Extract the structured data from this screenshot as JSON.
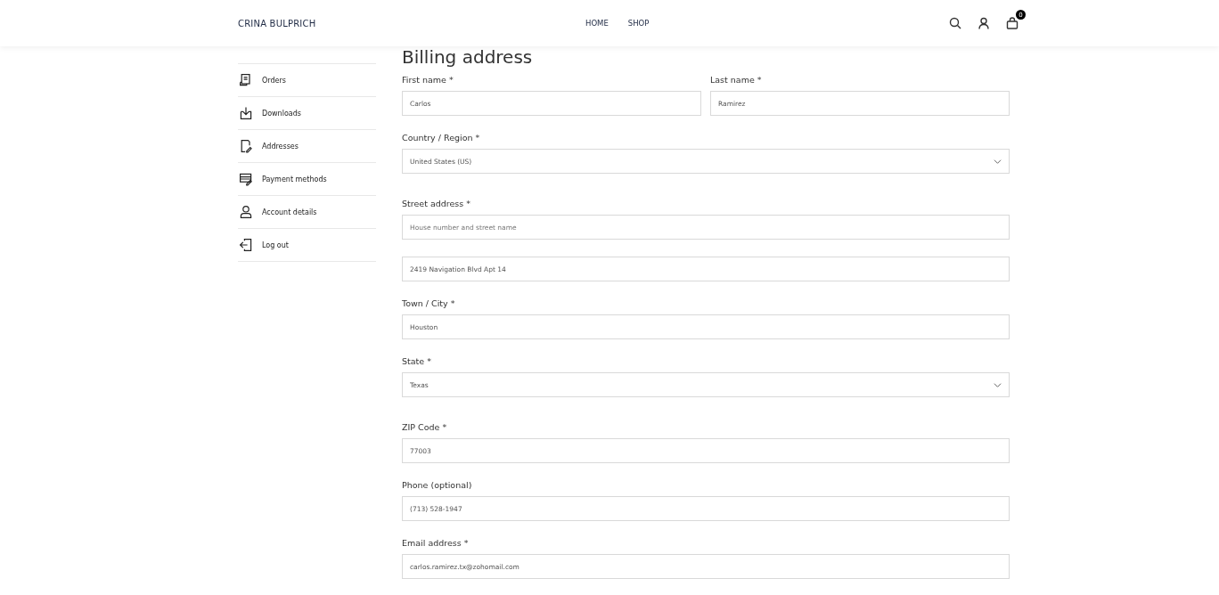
{
  "header": {
    "brand": "CRINA BULPRICH",
    "nav": [
      {
        "label": "HOME"
      },
      {
        "label": "SHOP"
      }
    ],
    "cart_count": "0"
  },
  "sidebar": {
    "items": [
      {
        "label": "Orders"
      },
      {
        "label": "Downloads"
      },
      {
        "label": "Addresses"
      },
      {
        "label": "Payment methods"
      },
      {
        "label": "Account details"
      },
      {
        "label": "Log out"
      }
    ]
  },
  "form": {
    "title": "Billing address",
    "rows": [
      {
        "fields": [
          {
            "kind": "text",
            "label": "First name *",
            "value": "Carlos"
          },
          {
            "kind": "text",
            "label": "Last name *",
            "value": "Ramirez"
          }
        ]
      },
      {
        "fields": [
          {
            "kind": "select",
            "label": "Country / Region *",
            "value": "United States (US)"
          }
        ]
      },
      {
        "fields": [
          {
            "kind": "text",
            "label": "Street address *",
            "placeholder": "House number and street name"
          }
        ]
      },
      {
        "fields": [
          {
            "kind": "text",
            "value": "2419 Navigation Blvd Apt 14"
          }
        ]
      },
      {
        "fields": [
          {
            "kind": "text",
            "label": "Town / City *",
            "value": "Houston"
          }
        ]
      },
      {
        "fields": [
          {
            "kind": "select",
            "label": "State *",
            "value": "Texas"
          }
        ]
      },
      {
        "fields": [
          {
            "kind": "text",
            "label": "ZIP Code *",
            "value": "77003"
          }
        ]
      },
      {
        "fields": [
          {
            "kind": "text",
            "label": "Phone (optional)",
            "value": "(713) 528-1947"
          }
        ]
      },
      {
        "fields": [
          {
            "kind": "text",
            "label": "Email address *",
            "value": "carlos.ramirez.tx@zohomail.com"
          }
        ]
      }
    ]
  }
}
